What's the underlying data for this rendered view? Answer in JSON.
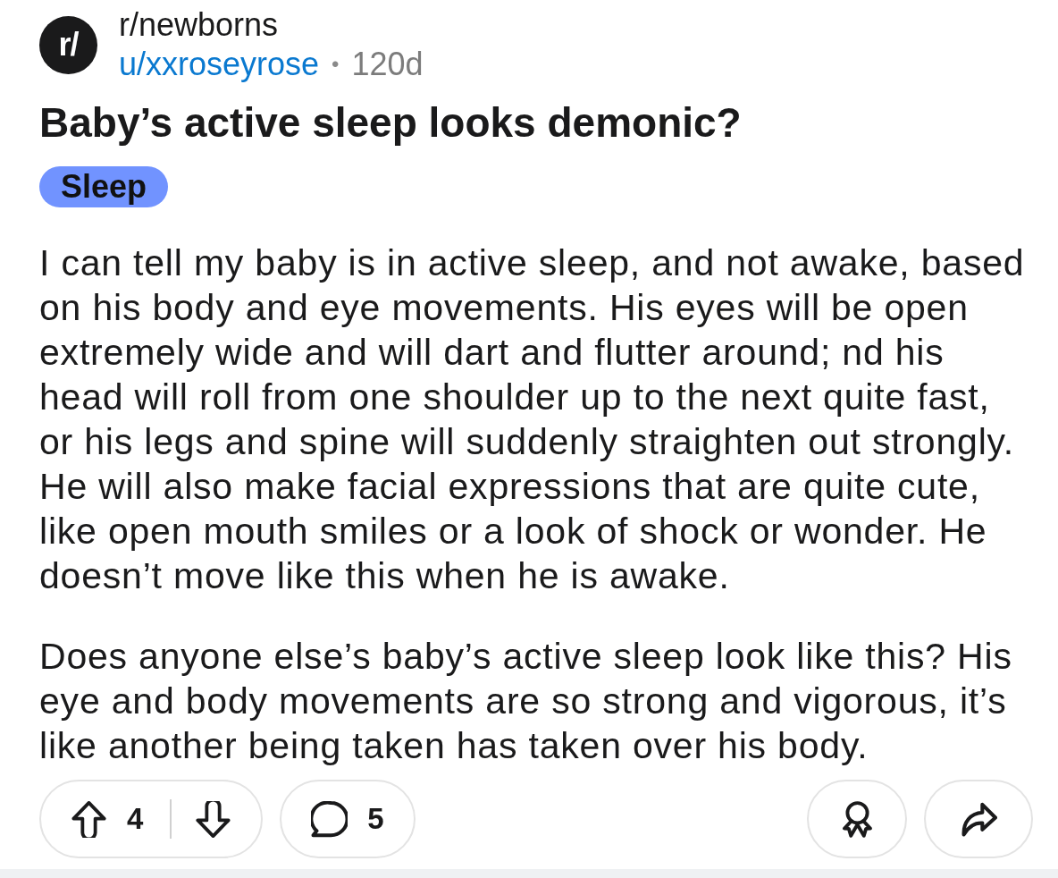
{
  "post": {
    "avatar": "r/",
    "subreddit": "r/newborns",
    "author": "u/xxroseyrose",
    "separator": "•",
    "age": "120d",
    "title": "Baby’s active sleep looks demonic?",
    "flair": "Sleep",
    "body": [
      "I can tell my baby is in active sleep, and not awake, based on his body and eye movements. His eyes will be open extremely wide and will dart and flutter around; nd his head will roll from one shoulder up to the next quite fast, or his legs and spine will suddenly straighten out strongly. He will also make facial expressions that are quite cute, like open mouth smiles or a look of shock or wonder. He doesn’t move like this when he is awake.",
      "Does anyone else’s baby’s active sleep look like this? His eye and body movements are so strong and vigorous, it’s like another being taken has taken over his body."
    ]
  },
  "actions": {
    "score": "4",
    "comments": "5"
  }
}
